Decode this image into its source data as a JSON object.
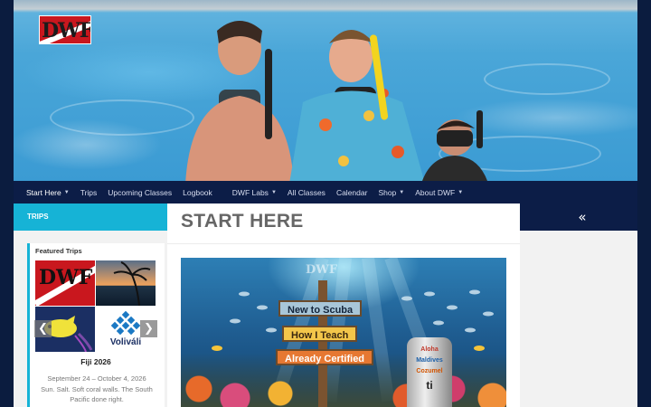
{
  "header": {
    "logo_text": "DWF"
  },
  "nav": {
    "items": [
      {
        "label": "Start Here",
        "dropdown": true,
        "active": true
      },
      {
        "label": "Trips",
        "dropdown": false
      },
      {
        "label": "Upcoming Classes",
        "dropdown": false
      },
      {
        "label": "Logbook",
        "dropdown": false
      },
      {
        "label": "DWF Labs",
        "dropdown": true
      },
      {
        "label": "All Classes",
        "dropdown": false
      },
      {
        "label": "Calendar",
        "dropdown": false
      },
      {
        "label": "Shop",
        "dropdown": true
      },
      {
        "label": "About DWF",
        "dropdown": true
      }
    ]
  },
  "sidebar_left": {
    "section_title": "TRIPS",
    "widget_title": "Featured Trips",
    "tiles": [
      {
        "text": "DWF"
      },
      {
        "text": ""
      },
      {
        "text": ""
      },
      {
        "text": "Voliváli"
      }
    ],
    "prev_icon": "❮",
    "next_icon": "❯",
    "trip": {
      "name": "Fiji 2026",
      "dates": "September 24 – October 4, 2026",
      "description": "Sun. Salt. Soft coral walls. The South Pacific done right."
    }
  },
  "main": {
    "page_title": "START HERE",
    "hero": {
      "logo_text": "DWF",
      "signs": [
        "New to Scuba",
        "How I Teach",
        "Already Certified"
      ],
      "tank_labels": [
        "Aloha",
        "Maldives",
        "Cozumel",
        "ti"
      ]
    }
  },
  "sidebar_right": {
    "collapse_icon": "«"
  },
  "colors": {
    "nav_bg": "#0c1d47",
    "accent": "#16b3d6",
    "page_title": "#666666"
  }
}
